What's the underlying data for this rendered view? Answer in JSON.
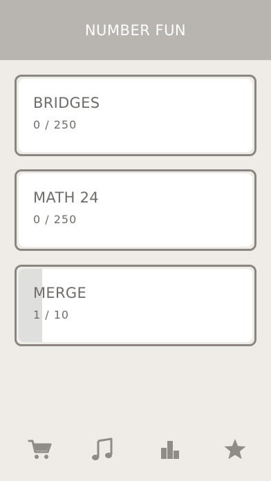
{
  "header": {
    "title": "NUMBER FUN"
  },
  "games": [
    {
      "title": "BRIDGES",
      "score": "0 / 250",
      "progress": 0
    },
    {
      "title": "MATH 24",
      "score": "0 / 250",
      "progress": 0
    },
    {
      "title": "MERGE",
      "score": "1 / 10",
      "progress": 0.1
    }
  ],
  "bottom_nav": {
    "icons": [
      "cart-icon",
      "music-note-icon",
      "bar-chart-icon",
      "star-icon"
    ]
  },
  "colors": {
    "header_bg": "#b8b5b0",
    "page_bg": "#efebe7",
    "card_border": "#8a8580",
    "text": "#6f6b68",
    "icon": "#8f8b87",
    "progress_fill": "#dfdfdd"
  }
}
